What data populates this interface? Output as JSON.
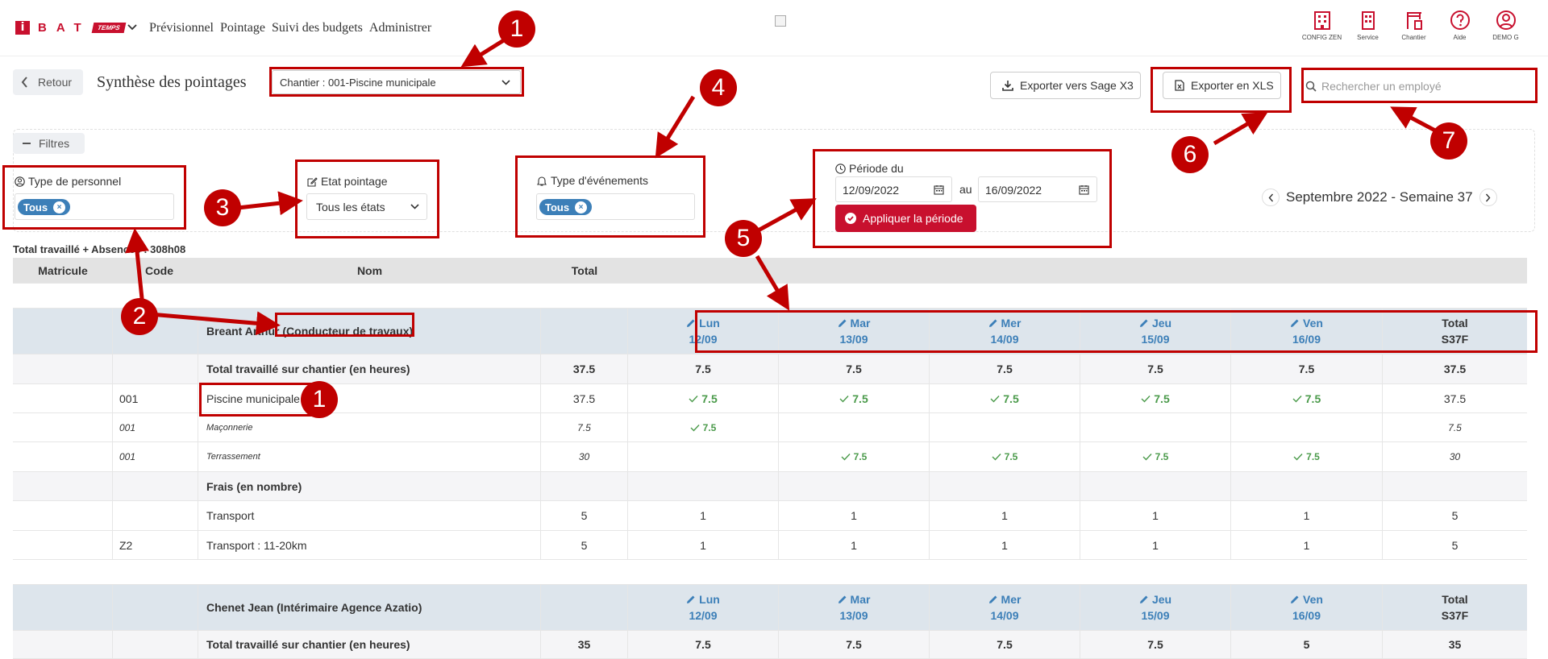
{
  "nav": {
    "logo_mark": "i",
    "logo_letters": "BAT",
    "logo_temps": "TEMPS",
    "items": [
      "Prévisionnel",
      "Pointage",
      "Suivi des budgets",
      "Administrer"
    ]
  },
  "top_icons": [
    {
      "icon": "building-icon",
      "label": "CONFIG ZEN"
    },
    {
      "icon": "office-icon",
      "label": "Service"
    },
    {
      "icon": "crane-icon",
      "label": "Chantier"
    },
    {
      "icon": "help-icon",
      "label": "Aide"
    },
    {
      "icon": "user-icon",
      "label": "DEMO G"
    }
  ],
  "header": {
    "back_label": "Retour",
    "title": "Synthèse des pointages",
    "chantier_select": "Chantier : 001-Piscine municipale",
    "export_sage": "Exporter vers Sage X3",
    "export_xls": "Exporter en XLS",
    "search_placeholder": "Rechercher un employé"
  },
  "filters": {
    "toggle_label": "Filtres",
    "type_personnel_label": "Type de personnel",
    "type_personnel_chip": "Tous",
    "etat_label": "Etat pointage",
    "etat_value": "Tous les états",
    "type_evenements_label": "Type d'événements",
    "type_evenements_chip": "Tous",
    "periode_label": "Période du",
    "date_from": "12/09/2022",
    "date_to": "16/09/2022",
    "au": "au",
    "apply_label": "Appliquer la période",
    "week_label": "Septembre 2022 - Semaine 37"
  },
  "summary": "Total travaillé + Absences : 308h08",
  "table": {
    "columns": [
      "Matricule",
      "Code",
      "Nom",
      "Total"
    ],
    "days": [
      {
        "day": "Lun",
        "date": "12/09"
      },
      {
        "day": "Mar",
        "date": "13/09"
      },
      {
        "day": "Mer",
        "date": "14/09"
      },
      {
        "day": "Jeu",
        "date": "15/09"
      },
      {
        "day": "Ven",
        "date": "16/09"
      }
    ],
    "week_total_label": "Total",
    "week_total_code": "S37F",
    "employees": [
      {
        "name": "Breant Arthur (Conducteur de travaux)",
        "rows": [
          {
            "style": "bold",
            "code": "",
            "name": "Total travaillé sur chantier (en heures)",
            "total": "37.5",
            "days": [
              "7.5",
              "7.5",
              "7.5",
              "7.5",
              "7.5"
            ],
            "week": "37.5"
          },
          {
            "style": "check",
            "code": "001",
            "name": "Piscine municipale",
            "total": "37.5",
            "days": [
              "7.5",
              "7.5",
              "7.5",
              "7.5",
              "7.5"
            ],
            "week": "37.5"
          },
          {
            "style": "sub",
            "code": "001",
            "name": "Maçonnerie",
            "total": "7.5",
            "days": [
              "7.5",
              "",
              "",
              "",
              ""
            ],
            "week": "7.5"
          },
          {
            "style": "sub",
            "code": "001",
            "name": "Terrassement",
            "total": "30",
            "days": [
              "",
              "7.5",
              "7.5",
              "7.5",
              "7.5"
            ],
            "week": "30"
          },
          {
            "style": "bold",
            "code": "",
            "name": "Frais (en nombre)",
            "total": "",
            "days": [
              "",
              "",
              "",
              "",
              ""
            ],
            "week": ""
          },
          {
            "style": "plain",
            "code": "",
            "name": "Transport",
            "total": "5",
            "days": [
              "1",
              "1",
              "1",
              "1",
              "1"
            ],
            "week": "5"
          },
          {
            "style": "plain",
            "code": "Z2",
            "name": "Transport : 11-20km",
            "total": "5",
            "days": [
              "1",
              "1",
              "1",
              "1",
              "1"
            ],
            "week": "5"
          }
        ]
      },
      {
        "name": "Chenet Jean (Intérimaire Agence Azatio)",
        "rows": [
          {
            "style": "bold",
            "code": "",
            "name": "Total travaillé sur chantier (en heures)",
            "total": "35",
            "days": [
              "7.5",
              "7.5",
              "7.5",
              "7.5",
              "5"
            ],
            "week": "35"
          }
        ]
      }
    ]
  },
  "markers": [
    "1",
    "1",
    "2",
    "3",
    "4",
    "5",
    "6",
    "7"
  ],
  "colors": {
    "brand_red": "#c8102e",
    "annotation_red": "#c00000",
    "chip_blue": "#3c7fb8",
    "check_green": "#4a9a4a"
  }
}
